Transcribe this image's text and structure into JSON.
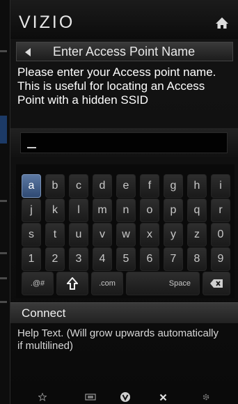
{
  "header": {
    "logo": "VIZIO",
    "home_icon": "home-icon"
  },
  "title_bar": {
    "title": "Enter Access Point Name",
    "back_icon": "back-arrow-icon"
  },
  "prompt": "Please enter your Access point name. This is useful for locating an Access Point with a hidden SSID",
  "input": {
    "value": "",
    "cursor": "_"
  },
  "keyboard": {
    "rows": [
      [
        "a",
        "b",
        "c",
        "d",
        "e",
        "f",
        "g",
        "h",
        "i"
      ],
      [
        "j",
        "k",
        "l",
        "m",
        "n",
        "o",
        "p",
        "q",
        "r"
      ],
      [
        "s",
        "t",
        "u",
        "v",
        "w",
        "x",
        "y",
        "z",
        "0"
      ],
      [
        "1",
        "2",
        "3",
        "4",
        "5",
        "6",
        "7",
        "8",
        "9"
      ]
    ],
    "special_row": {
      "symbols": ".@#",
      "shift_icon": "shift-arrow-icon",
      "dotcom": ".com",
      "space": "Space",
      "backspace_icon": "backspace-icon"
    },
    "selected_key": "a"
  },
  "connect": {
    "label": "Connect"
  },
  "help_text": "Help Text. (Will grow upwards automatically if multilined)",
  "bottom_bar": {
    "icons": [
      "star-icon",
      "widget-screen-icon",
      "vizio-v-icon",
      "close-icon",
      "gear-icon"
    ]
  },
  "colors": {
    "selected_key": "#4a6a96",
    "background": "#000000"
  }
}
